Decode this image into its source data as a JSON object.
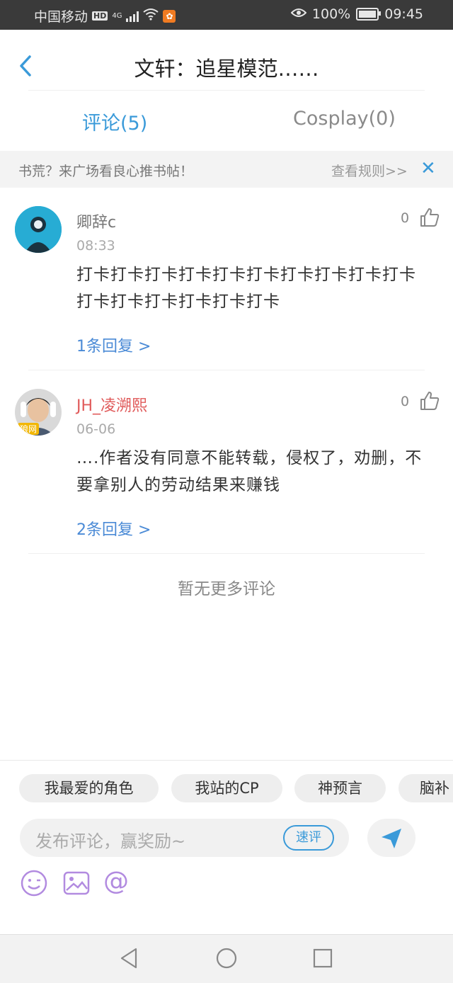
{
  "status_bar": {
    "carrier": "中国移动",
    "hd": "HD",
    "network": "4G",
    "battery": "100%",
    "time": "09:45"
  },
  "header": {
    "title": "文轩：追星模范……"
  },
  "tabs": [
    {
      "label": "评论(5)",
      "active": true
    },
    {
      "label": "Cosplay(0)",
      "active": false
    }
  ],
  "banner": {
    "message": "书荒？来广场看良心推书帖！",
    "rules_link": "查看规则>>"
  },
  "comments": [
    {
      "username": "卿辞c",
      "time": "08:33",
      "likes": "0",
      "content": "打卡打卡打卡打卡打卡打卡打卡打卡打卡打卡打卡打卡打卡打卡打卡打卡",
      "reply_link": "1条回复 >"
    },
    {
      "username": "JH_凌溯熙",
      "time": "06-06",
      "likes": "0",
      "content": "….作者没有同意不能转载，侵权了，劝删，不要拿别人的劳动结果来赚钱",
      "reply_link": "2条回复 >",
      "avatar_badge": "狼网"
    }
  ],
  "no_more": "暂无更多评论",
  "composer": {
    "chips": [
      "我最爱的角色",
      "我站的CP",
      "神预言",
      "脑补"
    ],
    "placeholder": "发布评论，赢奖励~",
    "quick_label": "速评"
  },
  "colors": {
    "accent": "#3a9ad9",
    "link": "#4a8ad6",
    "username_red": "#e05a5a",
    "tool_purple": "#b28be0"
  },
  "icons": [
    "back-arrow-icon",
    "close-icon",
    "thumb-up-icon",
    "send-icon",
    "emoji-icon",
    "image-icon",
    "at-icon",
    "nav-back-icon",
    "nav-home-icon",
    "nav-recents-icon"
  ]
}
